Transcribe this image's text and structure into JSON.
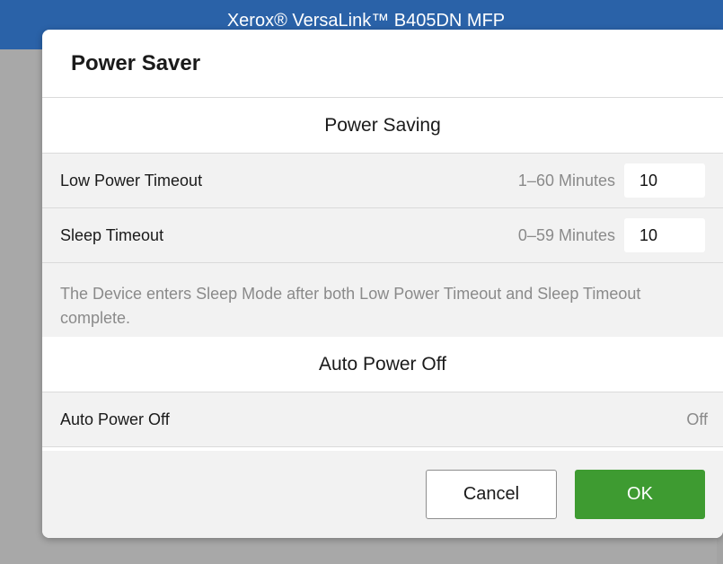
{
  "app": {
    "title": "Xerox® VersaLink™ B405DN MFP"
  },
  "dialog": {
    "title": "Power Saver",
    "sections": [
      {
        "header": "Power Saving",
        "rows": [
          {
            "label": "Low Power Timeout",
            "range": "1–60 Minutes",
            "value": "10"
          },
          {
            "label": "Sleep Timeout",
            "range": "0–59 Minutes",
            "value": "10"
          }
        ],
        "note": "The Device enters Sleep Mode after both Low Power Timeout and Sleep Timeout complete."
      },
      {
        "header": "Auto Power Off",
        "rows": [
          {
            "label": "Auto Power Off",
            "value": "Off"
          }
        ]
      }
    ],
    "buttons": {
      "cancel": "Cancel",
      "ok": "OK"
    }
  },
  "colors": {
    "header_bg": "#2a62a8",
    "ok_button": "#3e9b31",
    "overlay": "#a8a8a8"
  }
}
